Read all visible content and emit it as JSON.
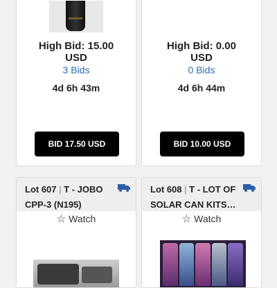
{
  "cards_top": [
    {
      "high_bid": "High Bid: 15.00",
      "currency": "USD",
      "bids": "3 Bids",
      "time_left": "4d 6h 43m",
      "bid_button": "BID 17.50 USD"
    },
    {
      "high_bid": "High Bid: 0.00",
      "currency": "USD",
      "bids": "0 Bids",
      "time_left": "4d 6h 44m",
      "bid_button": "BID 10.00 USD"
    }
  ],
  "cards_bottom": [
    {
      "lot_label": "Lot 607",
      "separator": "|",
      "title": "T - JOBO CPP-3 (N195)",
      "watch": "Watch",
      "icon": "shipping-truck-icon"
    },
    {
      "lot_label": "Lot 608",
      "separator": "|",
      "title": "T - LOT OF SOLAR CAN KITS…",
      "watch": "Watch",
      "icon": "shipping-truck-icon"
    }
  ],
  "colors": {
    "link": "#2c6fb5",
    "button_bg": "#000000",
    "truck": "#2b5fa6",
    "card_header_bg": "#eeeeee"
  }
}
